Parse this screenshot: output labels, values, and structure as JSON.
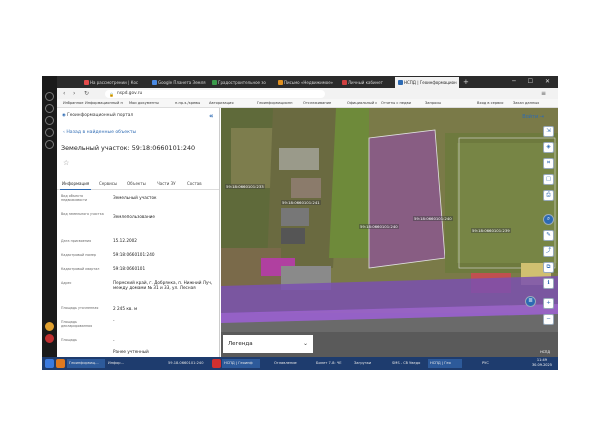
{
  "tabs": [
    "На рассмотрении | Кос",
    "Google Планета Земля",
    "Градостроительное зо",
    "Письмо «Недвижимое»",
    "Личный кабинет",
    "НСПД | Геоинформацион"
  ],
  "browser": {
    "url": "nspd.gov.ru"
  },
  "bookmarks": [
    "Избранное",
    "Информационный п",
    "Мои документы",
    "п.пр.э./кревы",
    "Авторизация",
    "Геоинформационн",
    "Отслеживание",
    "Официальный с",
    "Отчеты с недви",
    "Запросы",
    "Вход в сервис",
    "Заказ данных"
  ],
  "panel": {
    "header": "Геоинформационный портал",
    "back_link": "Назад в найденные объекты",
    "title": "Земельный участок: 59:18:0660101:240",
    "tabs": [
      "Информация",
      "Сервисы",
      "Объекты",
      "Части ЗУ",
      "Состав"
    ],
    "fields": [
      {
        "label": "Вид объекта недвижимости",
        "value": "Земельный участок"
      },
      {
        "label": "Вид земельного участка",
        "value": "Землепользование"
      },
      {
        "label": "Дата присвоения",
        "value": "15.12.2002"
      },
      {
        "label": "Кадастровый номер",
        "value": "59:18:0660101:240"
      },
      {
        "label": "Кадастровый квартал",
        "value": "59:18:0660101"
      },
      {
        "label": "Адрес",
        "value": "Пермский край, г. Добрянка, п. Нижний Луч, между домами № 31 и 33, ул. Лесная"
      },
      {
        "label": "Площадь уточненная",
        "value": "2 245 кв. м"
      },
      {
        "label": "Площадь декларированная",
        "value": "-"
      },
      {
        "label": "Площадь",
        "value": "-"
      },
      {
        "value": "Ранее учтенный"
      }
    ]
  },
  "map": {
    "login": "Войти",
    "legend": "Легенда",
    "labels": [
      "59:18:0660101:233",
      "59:18:0660101:241",
      "59:18:0660101:240",
      "59:18:0660101:240",
      "59:18:0660101:239"
    ],
    "scale": "НСПД"
  },
  "taskbar": {
    "0": "Геоинформац...",
    "1": "Инфор...",
    "2": "59.18.0660101:240",
    "3": "НСПД | Геоинф",
    "4": "Оглавление",
    "5": "Билет 7-8: ЧЕ",
    "6": "Загрузки",
    "7": "SMS - Сб Уведо",
    "8": "НСПД | Гео",
    "9": "РУС",
    "time": "11:49",
    "date": "30.09.2025"
  }
}
